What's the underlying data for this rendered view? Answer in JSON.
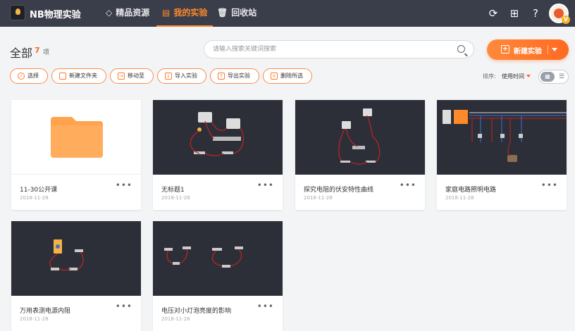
{
  "app": {
    "title": "NB物理实验"
  },
  "nav": [
    {
      "label": "精品资源",
      "icon": "diamond-icon"
    },
    {
      "label": "我的实验",
      "icon": "book-icon",
      "active": true
    },
    {
      "label": "回收站",
      "icon": "trash-icon"
    }
  ],
  "header": {
    "title": "全部",
    "count": "7",
    "count_unit": "项",
    "search_placeholder": "请输入搜索关键词搜索",
    "new_button": "新建实验"
  },
  "toolbar": {
    "buttons": [
      "选择",
      "新建文件夹",
      "移动至",
      "导入实验",
      "导出实验",
      "删除所选"
    ],
    "sort_label": "排序:",
    "sort_value": "使用时间"
  },
  "cards": [
    {
      "title": "11-30公开课",
      "date": "2018-11-28",
      "kind": "folder"
    },
    {
      "title": "无标题1",
      "date": "2018-11-28",
      "kind": "circuit"
    },
    {
      "title": "探究电阻的伏安特性曲线",
      "date": "2018-11-28",
      "kind": "circuit"
    },
    {
      "title": "家庭电路照明电路",
      "date": "2018-11-28",
      "kind": "circuit"
    },
    {
      "title": "万用表测电源内阻",
      "date": "2018-11-28",
      "kind": "circuit"
    },
    {
      "title": "电压对小灯泡亮度的影响",
      "date": "2018-11-28",
      "kind": "circuit"
    }
  ],
  "colors": {
    "accent": "#ff6a1f",
    "topbar": "#3a3d4a",
    "thumb_bg": "#2c2f38",
    "folder": "#ffa34d"
  }
}
